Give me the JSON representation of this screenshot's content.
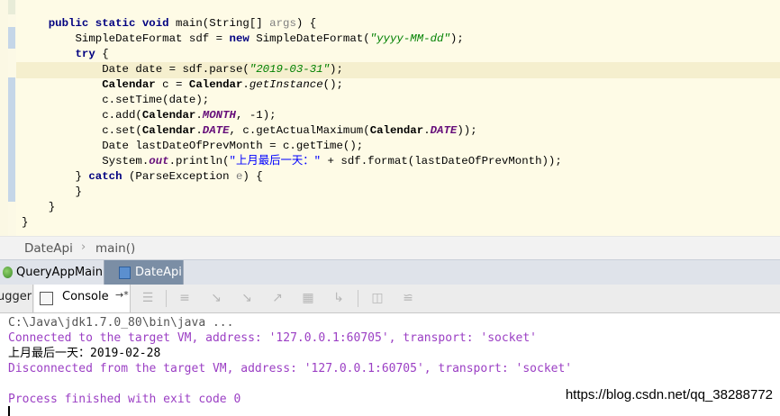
{
  "editor": {
    "lines": [
      [
        {
          "t": "    "
        },
        {
          "t": "public static void",
          "c": "kw"
        },
        {
          "t": " main(String[] "
        },
        {
          "t": "args",
          "c": "unused"
        },
        {
          "t": ") {"
        }
      ],
      [
        {
          "t": "        SimpleDateFormat sdf = "
        },
        {
          "t": "new",
          "c": "kw"
        },
        {
          "t": " SimpleDateFormat("
        },
        {
          "t": "\"yyyy-MM-dd\"",
          "c": "str"
        },
        {
          "t": ");"
        }
      ],
      [
        {
          "t": "        "
        },
        {
          "t": "try",
          "c": "kw"
        },
        {
          "t": " {"
        }
      ],
      [
        {
          "t": "            Date date = sdf.parse("
        },
        {
          "t": "\"2019-03-31\"",
          "c": "str"
        },
        {
          "t": ");"
        }
      ],
      [
        {
          "t": "            "
        },
        {
          "t": "Calendar",
          "c": "cls"
        },
        {
          "t": " c = "
        },
        {
          "t": "Calendar",
          "c": "cls"
        },
        {
          "t": "."
        },
        {
          "t": "getInstance",
          "c": "ital"
        },
        {
          "t": "();"
        }
      ],
      [
        {
          "t": "            c.setTime(date);"
        }
      ],
      [
        {
          "t": "            c.add("
        },
        {
          "t": "Calendar",
          "c": "cls"
        },
        {
          "t": "."
        },
        {
          "t": "MONTH",
          "c": "fld"
        },
        {
          "t": ", -1);"
        }
      ],
      [
        {
          "t": "            c.set("
        },
        {
          "t": "Calendar",
          "c": "cls"
        },
        {
          "t": "."
        },
        {
          "t": "DATE",
          "c": "fld"
        },
        {
          "t": ", c.getActualMaximum("
        },
        {
          "t": "Calendar",
          "c": "cls"
        },
        {
          "t": "."
        },
        {
          "t": "DATE",
          "c": "fld"
        },
        {
          "t": "));"
        }
      ],
      [
        {
          "t": "            Date lastDateOfPrevMonth = c.getTime();"
        }
      ],
      [
        {
          "t": "            System."
        },
        {
          "t": "out",
          "c": "fld"
        },
        {
          "t": ".println("
        },
        {
          "t": "\"上月最后一天：\"",
          "c": "strc"
        },
        {
          "t": " + sdf.format(lastDateOfPrevMonth));"
        }
      ],
      [
        {
          "t": "        } "
        },
        {
          "t": "catch",
          "c": "kw"
        },
        {
          "t": " (ParseException "
        },
        {
          "t": "e",
          "c": "unused"
        },
        {
          "t": ") {"
        }
      ],
      [
        {
          "t": "        }"
        }
      ],
      [
        {
          "t": "    }"
        }
      ],
      [
        {
          "t": "}"
        }
      ]
    ]
  },
  "breadcrumb": {
    "class_name": "DateApi",
    "separator": "›",
    "method_name": "main()"
  },
  "run_tabs": [
    {
      "label": "QueryAppMain",
      "icon": "run-config-icon"
    },
    {
      "label": "DateApi",
      "icon": "java-file-icon",
      "selected": true
    }
  ],
  "toolbar": {
    "debugger_label": "ugger",
    "console_label": "Console",
    "pin_glyph": "→*",
    "icons": [
      "print-icon",
      "step-over-icon",
      "step-into-icon",
      "force-step-into-icon",
      "step-out-icon",
      "drop-frame-icon",
      "run-to-cursor-icon",
      "evaluate-icon",
      "trace-icon"
    ]
  },
  "console": {
    "command": "C:\\Java\\jdk1.7.0_80\\bin\\java ...",
    "connected": "Connected to the target VM, address: '127.0.0.1:60705', transport: 'socket'",
    "output": "上月最后一天：2019-02-28",
    "disconnected": "Disconnected from the target VM, address: '127.0.0.1:60705', transport: 'socket'",
    "exit": "Process finished with exit code 0"
  },
  "watermark": "https://blog.csdn.net/qq_38288772",
  "colors": {
    "editor_bg": "#fefbe6",
    "keyword": "#000080",
    "string": "#008000",
    "system_message": "#9b3fc4",
    "selected_tab": "#7b8ea5"
  }
}
